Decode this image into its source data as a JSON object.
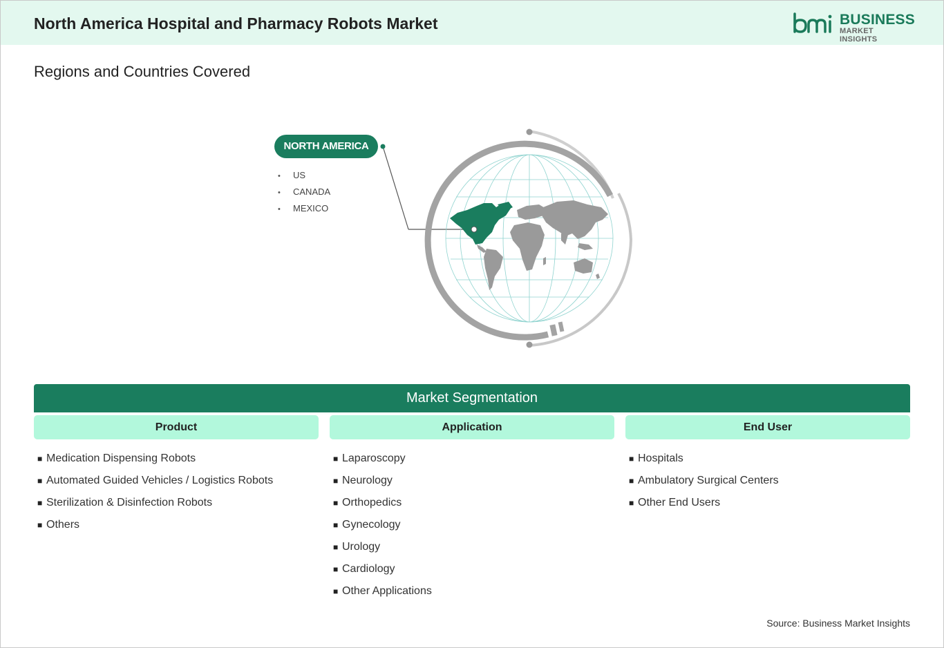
{
  "header": {
    "title": "North America Hospital and Pharmacy Robots Market",
    "logo_line1": "BUSINESS",
    "logo_line2": "MARKET INSIGHTS",
    "background": "#e3f8ef"
  },
  "regions": {
    "heading": "Regions and Countries Covered",
    "region_label": "NORTH AMERICA",
    "countries": [
      "US",
      "CANADA",
      "MEXICO"
    ],
    "highlight_color": "#1a7d5e"
  },
  "segmentation": {
    "title": "Market Segmentation",
    "columns": [
      {
        "header": "Product",
        "items": [
          "Medication Dispensing Robots",
          "Automated Guided Vehicles / Logistics Robots",
          "Sterilization & Disinfection Robots",
          "Others"
        ]
      },
      {
        "header": "Application",
        "items": [
          "Laparoscopy",
          "Neurology",
          "Orthopedics",
          "Gynecology",
          "Urology",
          "Cardiology",
          "Other Applications"
        ]
      },
      {
        "header": "End User",
        "items": [
          "Hospitals",
          "Ambulatory Surgical Centers",
          "Other End Users"
        ]
      }
    ],
    "bar_color": "#1a7d5e",
    "column_header_color": "#b2f8dc"
  },
  "source": "Source: Business Market Insights",
  "icons": {
    "logo": "bmi-logo-icon",
    "globe": "world-globe-icon",
    "bullet": "square-bullet-icon"
  }
}
